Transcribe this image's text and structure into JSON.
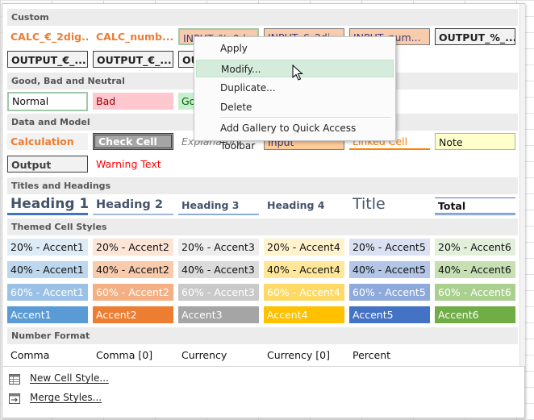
{
  "gallery": {
    "sections": {
      "custom": "Custom",
      "good_bad_neutral": "Good, Bad and Neutral",
      "data_model": "Data and Model",
      "titles_headings": "Titles and Headings",
      "themed": "Themed Cell Styles",
      "number_format": "Number Format"
    },
    "custom": {
      "calc_eur": "CALC_€_2dig...",
      "calc_num": "CALC_numb...",
      "input_pct": "INPUT_%_0d...",
      "input_eur": "INPUT_€_2di...",
      "input_num": "INPUT_num...",
      "output_pct": "OUTPUT_%_...",
      "output_eur1": "OUTPUT_€_...",
      "output_eur2": "OUTPUT_€_...",
      "output_cut": "OU"
    },
    "good_bad": {
      "normal": "Normal",
      "bad": "Bad",
      "good_cut": "Go"
    },
    "data_model": {
      "calculation": "Calculation",
      "check_cell": "Check Cell",
      "explanatory": "Explanatory ...",
      "input": "Input",
      "linked_cell": "Linked Cell",
      "note": "Note",
      "output": "Output",
      "warning_text": "Warning Text"
    },
    "titles": {
      "heading1": "Heading 1",
      "heading2": "Heading 2",
      "heading3": "Heading 3",
      "heading4": "Heading 4",
      "title": "Title",
      "total": "Total"
    },
    "themed": {
      "row20": [
        "20% - Accent1",
        "20% - Accent2",
        "20% - Accent3",
        "20% - Accent4",
        "20% - Accent5",
        "20% - Accent6"
      ],
      "row40": [
        "40% - Accent1",
        "40% - Accent2",
        "40% - Accent3",
        "40% - Accent4",
        "40% - Accent5",
        "40% - Accent6"
      ],
      "row60": [
        "60% - Accent1",
        "60% - Accent2",
        "60% - Accent3",
        "60% - Accent4",
        "60% - Accent5",
        "60% - Accent6"
      ],
      "row100": [
        "Accent1",
        "Accent2",
        "Accent3",
        "Accent4",
        "Accent5",
        "Accent6"
      ]
    },
    "number_format": {
      "comma": "Comma",
      "comma0": "Comma [0]",
      "currency": "Currency",
      "currency0": "Currency [0]",
      "percent": "Percent"
    },
    "bottom_menu": {
      "new_cell_style": "New Cell Style...",
      "merge_styles": "Merge Styles..."
    }
  },
  "context_menu": {
    "apply": "Apply",
    "modify": "Modify...",
    "duplicate": "Duplicate...",
    "delete": "Delete",
    "add_gallery": "Add Gallery to Quick Access Toolbar"
  },
  "colors": {
    "accent1": "#5b9bd5",
    "accent2": "#ed7d31",
    "accent3": "#a5a5a5",
    "accent4": "#ffc000",
    "accent5": "#4472c4",
    "accent6": "#70ad47",
    "highlight": "#d5ebdb"
  }
}
